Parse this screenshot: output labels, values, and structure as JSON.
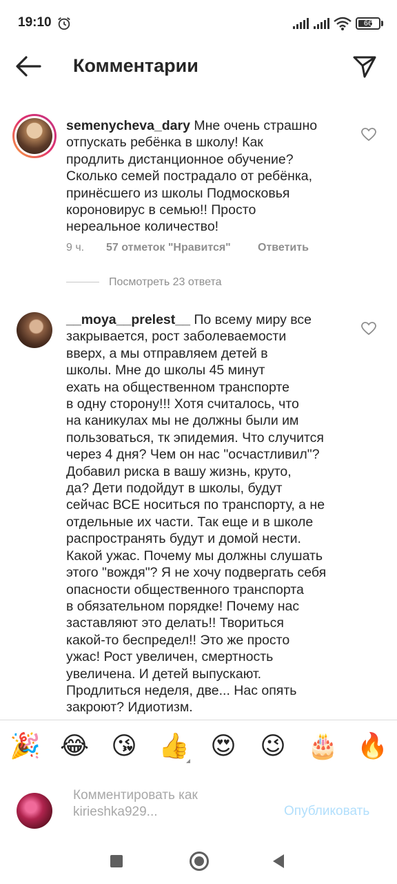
{
  "status_bar": {
    "time": "19:10",
    "battery": "66",
    "battery_level": 0.66
  },
  "header": {
    "title": "Комментарии"
  },
  "comments": [
    {
      "username": "semenycheva_dary",
      "text": "Мне очень страшно\nотпускать ребёнка в школу! Как\nпродлить дистанционное обучение?\nСколько семей пострадало от ребёнка,\nпринёсшего из школы Подмосковья\nкороновирус в семью!! Просто\nнереальное количество!",
      "time": "9 ч.",
      "likes": "57 отметок \"Нравится\"",
      "reply_label": "Ответить",
      "view_replies": "Посмотреть 23 ответа"
    },
    {
      "username": "__moya__prelest__",
      "text": "По всему миру все\nзакрывается, рост заболеваемости\nвверх, а мы отправляем детей в\nшколы. Мне до школы 45 минут\nехать на общественном транспорте\nв одну сторону!!! Хотя считалось, что\nна каникулах мы не должны были им\nпользоваться, тк эпидемия. Что случится\nчерез 4 дня? Чем он нас \"осчастливил\"?\nДобавил риска в вашу жизнь, круто,\nда? Дети подойдут в школы, будут\nсейчас ВСЕ носиться по транспорту, а не\nотдельные их части. Так еще и в школе\nраспространять будут и домой нести.\nКакой ужас. Почему мы должны слушать\nэтого \"вождя\"? Я не хочу подвергать себя\nопасности общественного транспорта\nв обязательном порядке! Почему нас\nзаставляют это делать!! Твориться\nкакой-то беспредел!! Это же просто\nужас! Рост увеличен, смертность\nувеличена. И детей выпускают.\nПродлиться неделя, две... Нас опять\nзакроют? Идиотизм."
    }
  ],
  "emoji_bar": {
    "emojis": [
      "🎉",
      "😂",
      "😘",
      "👍",
      "😍",
      "😉",
      "🎂",
      "🔥"
    ]
  },
  "comment_input": {
    "placeholder": "Комментировать как kirieshka929...",
    "publish_label": "Опубликовать"
  },
  "icons": {
    "back": "arrow-left-icon",
    "share": "paper-plane-icon",
    "like": "heart-outline-icon",
    "alarm": "alarm-clock-icon",
    "signal": "cell-signal-icon",
    "wifi": "wifi-icon"
  },
  "colors": {
    "text": "#262626",
    "secondary": "#8e8e8e",
    "publish_disabled": "#b2dffc",
    "story_ring_start": "#f9a53e",
    "story_ring_end": "#c13584"
  }
}
